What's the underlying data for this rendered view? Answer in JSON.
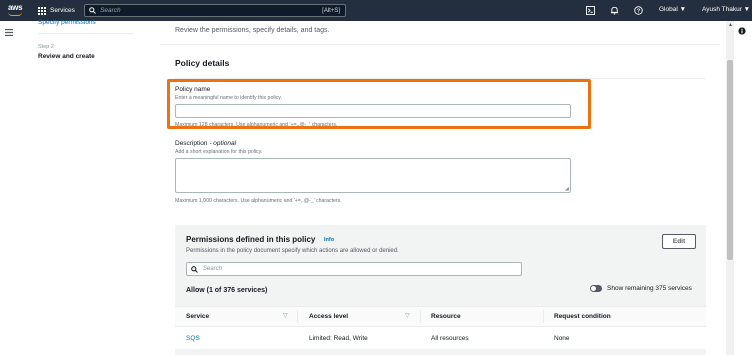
{
  "topbar": {
    "logo_text": "aws",
    "services_label": "Services",
    "search_placeholder": "Search",
    "search_shortcut": "[Alt+S]",
    "region_label": "Global ▼",
    "user_label": "Ayush Thakur ▼"
  },
  "steps": {
    "previous_link": "Specify permissions",
    "step_number": "Step 2",
    "current_step": "Review and create"
  },
  "main": {
    "description": "Review the permissions, specify details, and tags.",
    "policy_details": {
      "title": "Policy details",
      "name_label": "Policy name",
      "name_hint": "Enter a meaningful name to identify this policy.",
      "name_value": "",
      "name_constraint": "Maximum 128 characters. Use alphanumeric and '+=,.@-_' characters.",
      "desc_label": "Description",
      "desc_optional": "optional",
      "desc_hint": "Add a short explanation for this policy.",
      "desc_value": "",
      "desc_constraint": "Maximum 1,000 characters. Use alphanumeric and '+=,.@-_' characters."
    },
    "permissions": {
      "title": "Permissions defined in this policy",
      "info_link": "Info",
      "subtitle": "Permissions in the policy document specify which actions are allowed or denied.",
      "edit_label": "Edit",
      "search_placeholder": "Search",
      "allow_label": "Allow (1 of 376 services)",
      "show_remaining": "Show remaining 375 services",
      "columns": [
        "Service",
        "Access level",
        "Resource",
        "Request condition"
      ],
      "rows": [
        {
          "service": "SQS",
          "access_level": "Limited: Read, Write",
          "resource": "All resources",
          "request_condition": "None"
        }
      ]
    }
  },
  "colors": {
    "topbar_bg": "#232f3e",
    "highlight": "#ec7211",
    "link": "#0073bb"
  }
}
